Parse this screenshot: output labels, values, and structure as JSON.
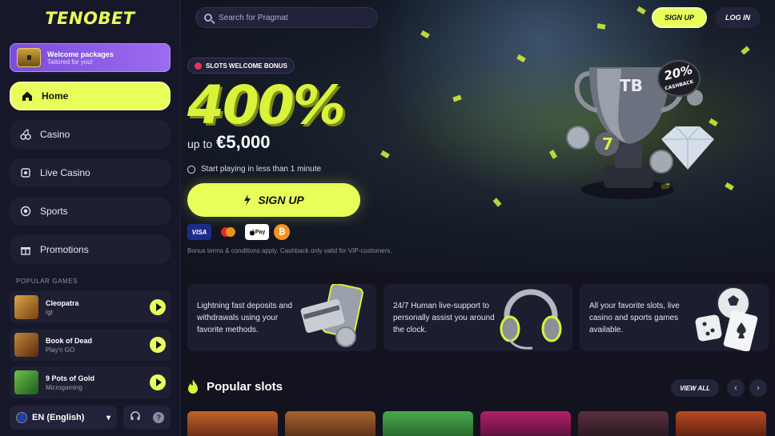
{
  "brand": {
    "logo": "TENOBET",
    "accent": "#e8ff5a"
  },
  "sidebar": {
    "welcome": {
      "title": "Welcome packages",
      "subtitle": "Tailored for you!"
    },
    "nav": [
      {
        "label": "Home",
        "icon": "home-icon",
        "active": true
      },
      {
        "label": "Casino",
        "icon": "cherries-icon"
      },
      {
        "label": "Live Casino",
        "icon": "live-casino-icon"
      },
      {
        "label": "Sports",
        "icon": "ball-icon"
      },
      {
        "label": "Promotions",
        "icon": "gift-icon"
      }
    ],
    "popular_label": "POPULAR GAMES",
    "games": [
      {
        "name": "Cleopatra",
        "provider": "Igt",
        "color": "#b5782d"
      },
      {
        "name": "Book of Dead",
        "provider": "Play'n GO",
        "color": "#9a5a1e"
      },
      {
        "name": "9 Pots of Gold",
        "provider": "Microgaming",
        "color": "#3a8f2c"
      }
    ],
    "language": "EN (English)"
  },
  "header": {
    "search_placeholder": "Search for Pragmat",
    "signup": "SIGN UP",
    "login": "LOG IN"
  },
  "hero": {
    "badge": "SLOTS WELCOME BONUS",
    "percent": "400%",
    "upto": "up to",
    "amount": "€5,000",
    "start": "Start playing in less than 1 minute",
    "cta": "SIGN UP",
    "payments": [
      "VISA",
      "mastercard",
      "Apple Pay",
      "bitcoin"
    ],
    "terms": "Bonus terms & conditions apply. Cashback only valid for VIP-customers.",
    "cashback_pct": "20%",
    "cashback_label": "CASHBACK",
    "trophy_mark": "TB"
  },
  "features": [
    {
      "text": "Lightning fast deposits and withdrawals using your favorite methods.",
      "icon": "card-phone-icon"
    },
    {
      "text": "24/7 Human live-support to personally assist you around the clock.",
      "icon": "headphones-icon"
    },
    {
      "text": "All your favorite slots, live casino and sports games available.",
      "icon": "dice-cards-icon"
    }
  ],
  "popular_slots": {
    "title": "Popular slots",
    "view_all": "VIEW ALL",
    "prev": "‹",
    "next": "›",
    "tiles": [
      "#8b3a1a",
      "#6b3a1c",
      "#2b7a3a",
      "#7a1a4e",
      "#3a2030",
      "#6a2a1c"
    ]
  }
}
